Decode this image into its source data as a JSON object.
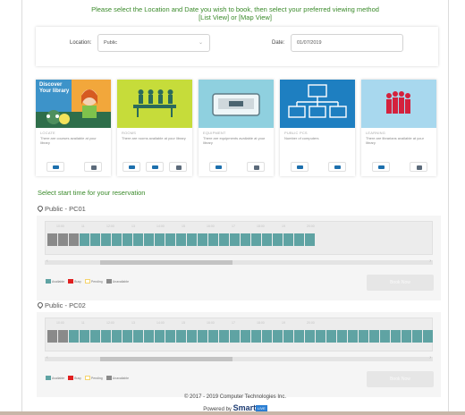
{
  "instructions": "Please select the Location and Date you wish to book, then select your preferred viewing method [List View] or [Map View]",
  "filters": {
    "location_label": "Location:",
    "location_value": "Public",
    "date_label": "Date:",
    "date_value": "01/07/2019"
  },
  "cards": [
    {
      "title": "LOCATE",
      "desc": "There are courses available at your library",
      "image_text": "Discover Your library",
      "buttons": [
        "list-icon",
        "calendar-icon"
      ]
    },
    {
      "title": "ROOMS",
      "desc": "There are rooms available at your library",
      "buttons": [
        "list-icon",
        "map-icon",
        "calendar-icon"
      ]
    },
    {
      "title": "EQUIPMENT",
      "desc": "There are equipments available at your library",
      "buttons": [
        "list-icon",
        "calendar-icon"
      ]
    },
    {
      "title": "PUBLIC PCS",
      "desc": "Number of computers",
      "buttons": [
        "list-icon",
        "map-icon"
      ]
    },
    {
      "title": "LEARNING",
      "desc": "There are librarians available at your library",
      "buttons": [
        "list-icon",
        "calendar-icon"
      ]
    }
  ],
  "section_title": "Select start time for your reservation",
  "resources": [
    {
      "name": "Public - PC01",
      "hours": [
        "10:00",
        "11",
        "12:00",
        "13",
        "14:00",
        "15",
        "16:00",
        "17",
        "18:00",
        "19",
        "20:00"
      ],
      "slots": [
        "u",
        "u",
        "u",
        "a",
        "a",
        "a",
        "a",
        "a",
        "a",
        "a",
        "a",
        "a",
        "a",
        "a",
        "a",
        "a",
        "a",
        "a",
        "a",
        "a",
        "a",
        "a",
        "a",
        "a",
        "a"
      ],
      "book_label": "Book Now"
    },
    {
      "name": "Public - PC02",
      "hours": [
        "10:00",
        "11",
        "12:00",
        "13",
        "14:00",
        "15",
        "16:00",
        "17",
        "18:00",
        "19",
        "20:00"
      ],
      "slots": [
        "u",
        "u",
        "a",
        "a",
        "a",
        "a",
        "a",
        "a",
        "a",
        "a",
        "a",
        "a",
        "a",
        "a",
        "a",
        "a",
        "a",
        "a",
        "a",
        "a",
        "a",
        "a",
        "a",
        "a",
        "a",
        "a",
        "a",
        "a",
        "a",
        "a",
        "a",
        "a",
        "a",
        "a",
        "a",
        "a"
      ],
      "book_label": "Book Now"
    }
  ],
  "legend": [
    {
      "label": "Available",
      "color": "#5fa3a3"
    },
    {
      "label": "Busy",
      "color": "#e02020"
    },
    {
      "label": "Pending",
      "color": "#f5d36b"
    },
    {
      "label": "Unavailable",
      "color": "#8a8a8a"
    }
  ],
  "footer": {
    "copyright": "© 2017 - 2019 Computer Technologies Inc.",
    "powered_by": "Powered by",
    "brand": "Smart",
    "brand_badge": "LIVE"
  }
}
